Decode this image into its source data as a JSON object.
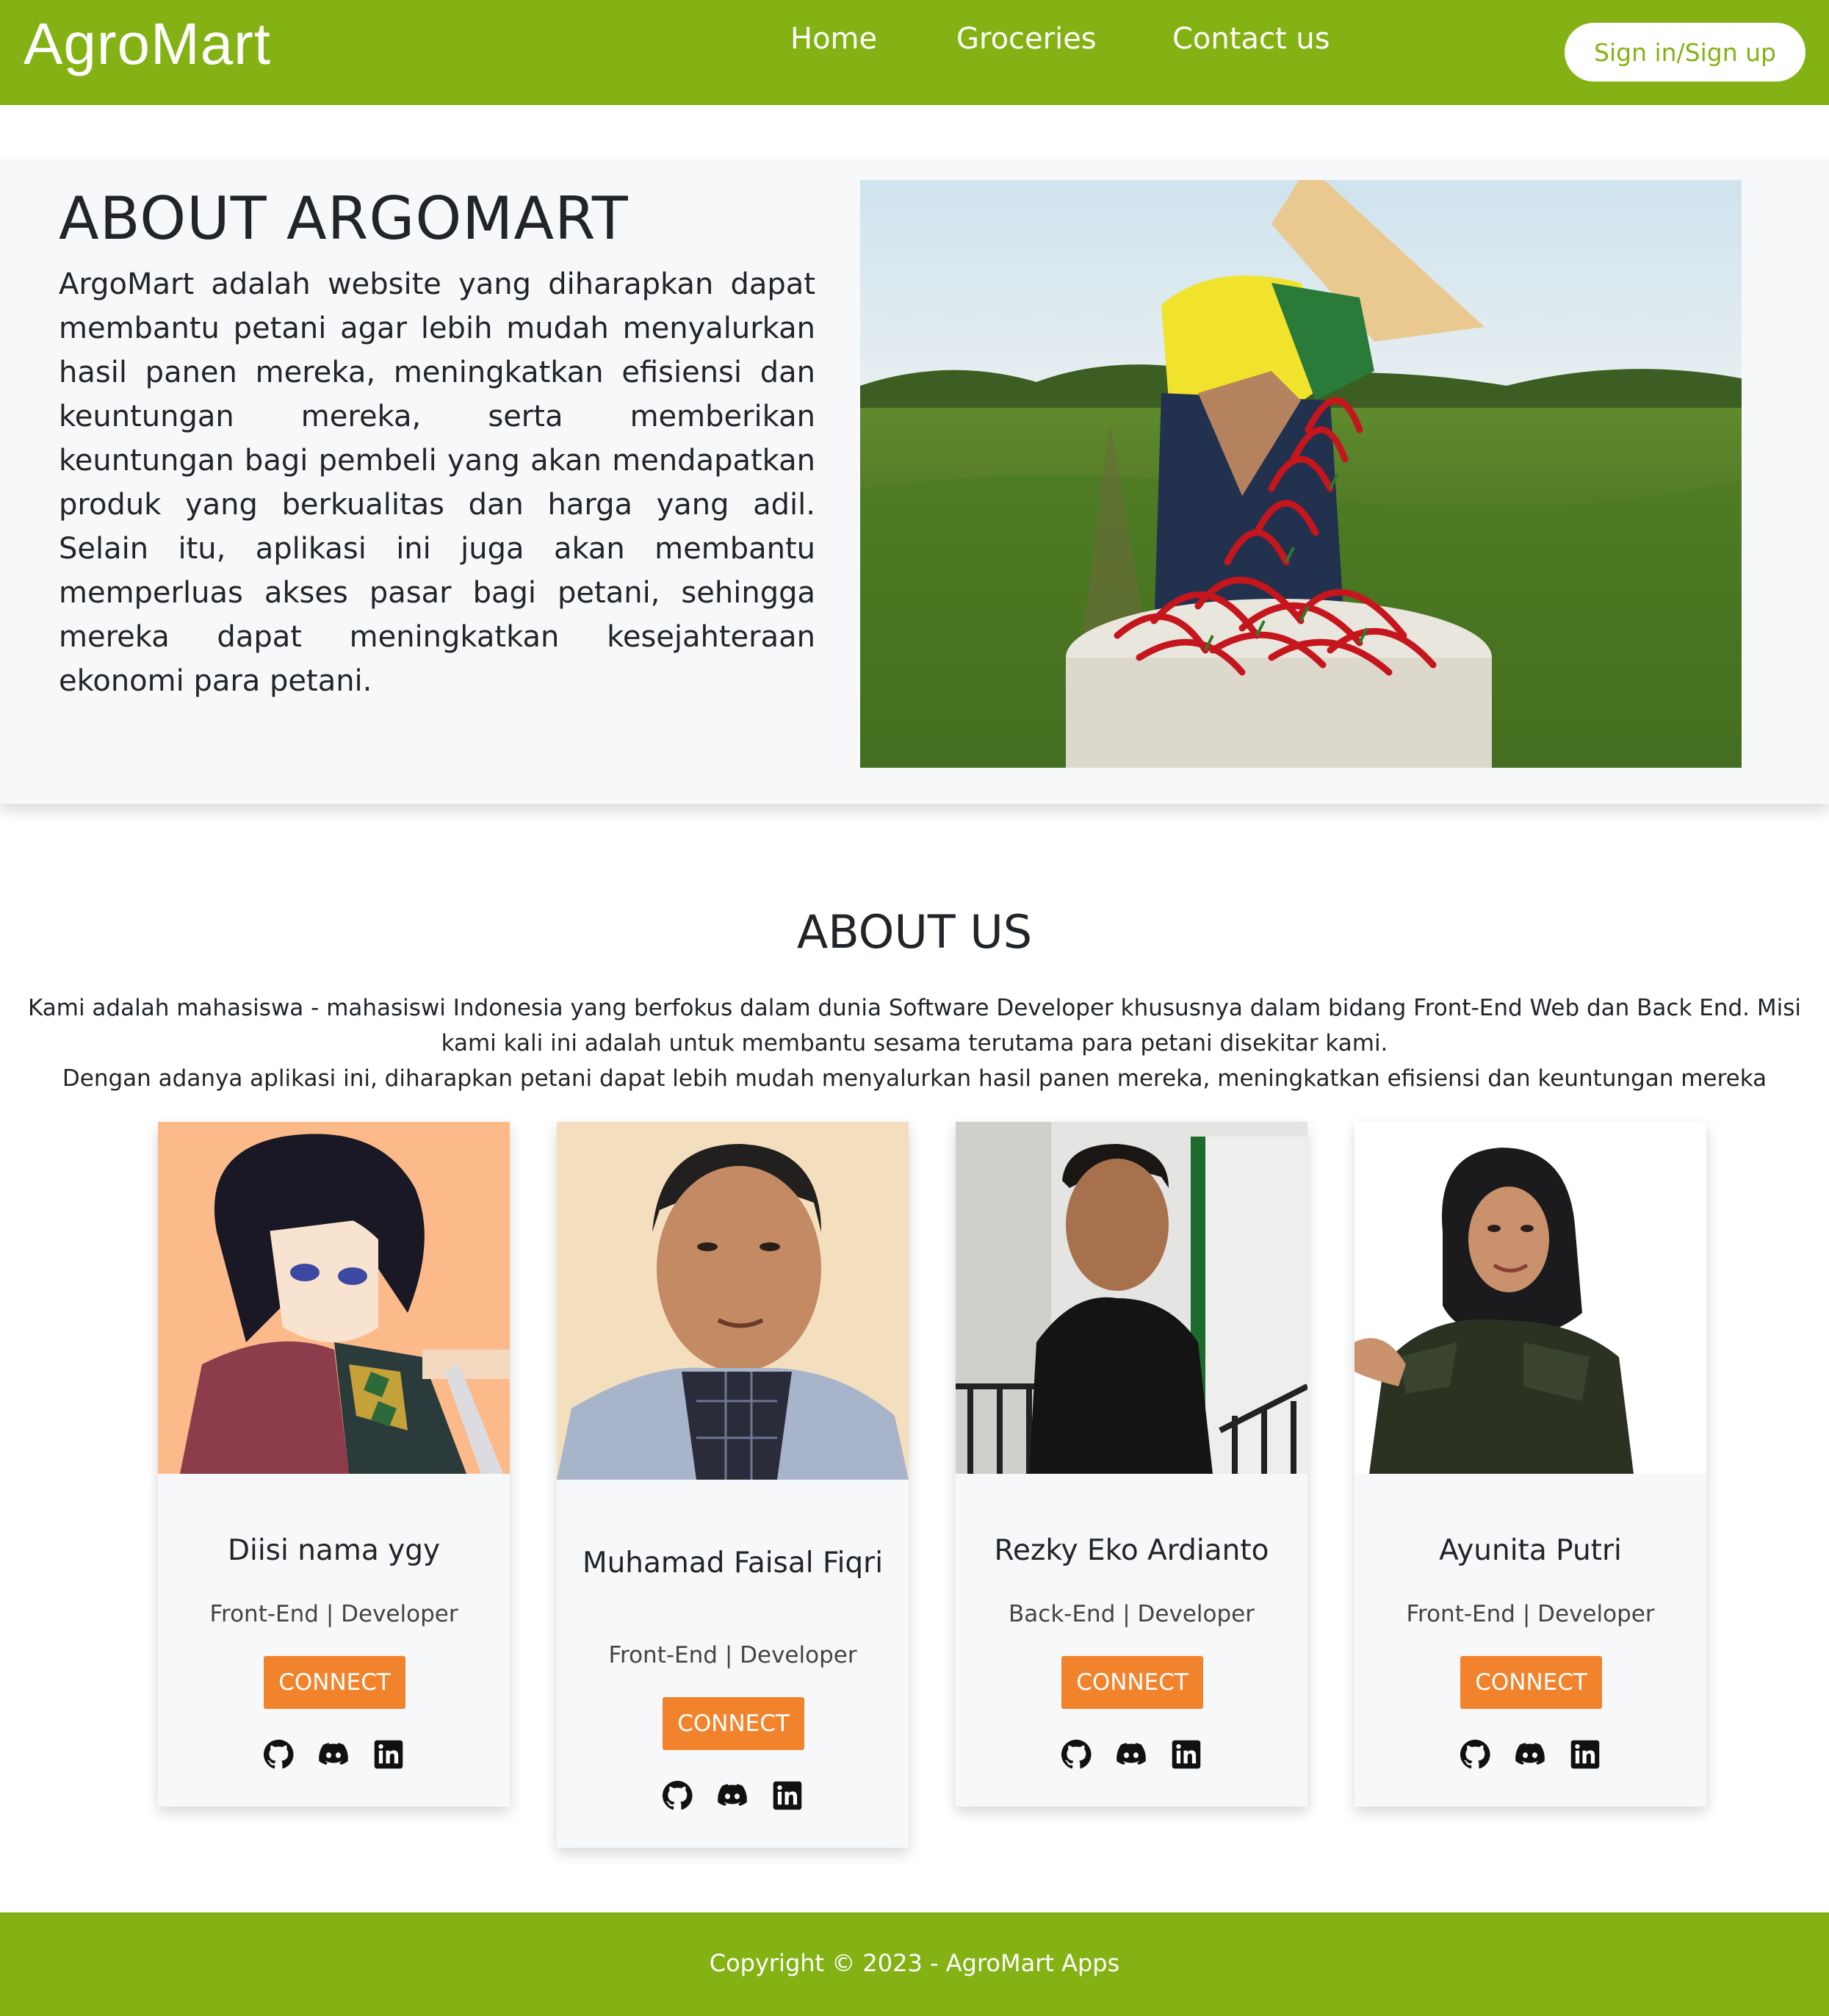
{
  "navbar": {
    "brand": "AgroMart",
    "links": [
      "Home",
      "Groceries",
      "Contact us"
    ],
    "signin_label": "Sign in/Sign up"
  },
  "about": {
    "title": "ABOUT ARGOMART",
    "text": "ArgoMart adalah website yang diharapkan dapat membantu petani agar lebih mudah menyalurkan hasil panen mereka, meningkatkan efisiensi dan keuntungan mereka, serta memberikan keuntungan bagi pembeli yang akan mendapatkan produk yang berkualitas dan harga yang adil. Selain itu, aplikasi ini juga akan membantu memperluas akses pasar bagi petani, sehingga mereka dapat meningkatkan kesejahteraan ekonomi para petani.",
    "image": "farmer-with-chili-peppers"
  },
  "about_us": {
    "title": "ABOUT US",
    "line1": "Kami adalah mahasiswa - mahasiswi Indonesia yang berfokus dalam dunia Software Developer khususnya dalam bidang Front-End Web dan Back End. Misi kami kali ini adalah untuk membantu sesama terutama para petani disekitar kami.",
    "line2": "Dengan adanya aplikasi ini, diharapkan petani dapat lebih mudah menyalurkan hasil panen mereka, meningkatkan efisiensi dan keuntungan mereka"
  },
  "team": [
    {
      "name": "Diisi nama ygy",
      "role_area": "Front-End",
      "role_sep": "|",
      "role_title": "Developer",
      "connect_label": "CONNECT",
      "photo": "anime-character-portrait"
    },
    {
      "name": "Muhamad Faisal Fiqri",
      "role_area": "Front-End",
      "role_sep": "|",
      "role_title": "Developer",
      "connect_label": "CONNECT",
      "photo": "man-in-blue-blazer-portrait"
    },
    {
      "name": "Rezky Eko Ardianto",
      "role_area": "Back-End",
      "role_sep": "|",
      "role_title": "Developer",
      "connect_label": "CONNECT",
      "photo": "man-in-black-shirt-portrait"
    },
    {
      "name": "Ayunita Putri",
      "role_area": "Front-End",
      "role_sep": "|",
      "role_title": "Developer",
      "connect_label": "CONNECT",
      "photo": "woman-in-hijab-portrait"
    }
  ],
  "social_icons": [
    "github-icon",
    "discord-icon",
    "linkedin-icon"
  ],
  "footer": {
    "copyright": "Copyright © 2023 - AgroMart Apps"
  },
  "colors": {
    "brand_green": "#84b214",
    "connect_orange": "#f2832d",
    "section_bg": "#f7f8f9"
  }
}
